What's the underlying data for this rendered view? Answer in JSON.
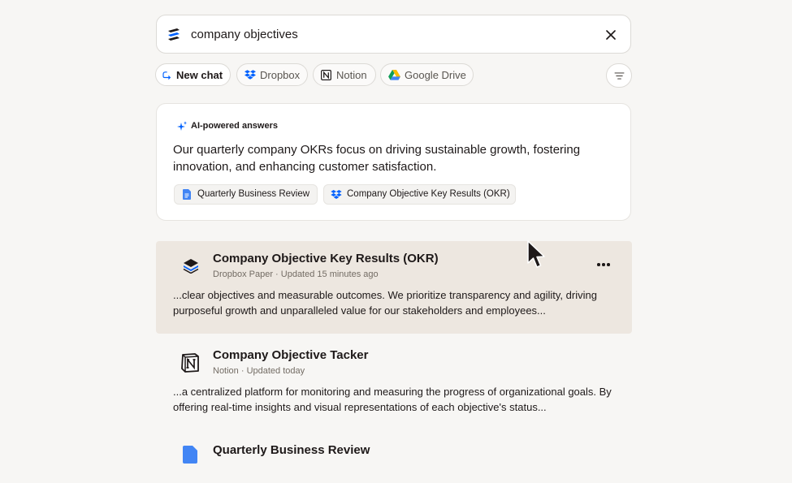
{
  "search": {
    "query": "company objectives"
  },
  "filters": [
    {
      "label": "New chat",
      "icon": "new-chat-icon"
    },
    {
      "label": "Dropbox",
      "icon": "dropbox-icon"
    },
    {
      "label": "Notion",
      "icon": "notion-icon"
    },
    {
      "label": "Google Drive",
      "icon": "google-drive-icon"
    }
  ],
  "ai_answer": {
    "heading": "AI-powered answers",
    "text": "Our quarterly company OKRs focus on driving sustainable growth, fostering innovation, and enhancing customer satisfaction.",
    "sources": [
      {
        "label": "Quarterly Business Review",
        "icon": "google-docs-icon"
      },
      {
        "label": "Company Objective Key Results (OKR)",
        "icon": "dropbox-icon"
      }
    ]
  },
  "results": [
    {
      "title": "Company Objective Key Results (OKR)",
      "meta": "Dropbox Paper · Updated 15 minutes ago",
      "snippet": "...clear objectives and measurable outcomes. We prioritize transparency and agility, driving purposeful growth and unparalleled value for our stakeholders and employees...",
      "icon": "dropbox-paper-icon"
    },
    {
      "title": "Company Objective Tacker",
      "meta": "Notion · Updated today",
      "snippet": "...a centralized platform for monitoring and measuring the progress of organizational goals. By offering real-time insights and visual representations of each objective's status...",
      "icon": "notion-icon"
    },
    {
      "title": "Quarterly Business Review",
      "icon": "google-docs-icon"
    }
  ],
  "colors": {
    "dropbox_blue": "#0061fe",
    "highlight": "#ede7e0",
    "background": "#f7f6f4"
  }
}
